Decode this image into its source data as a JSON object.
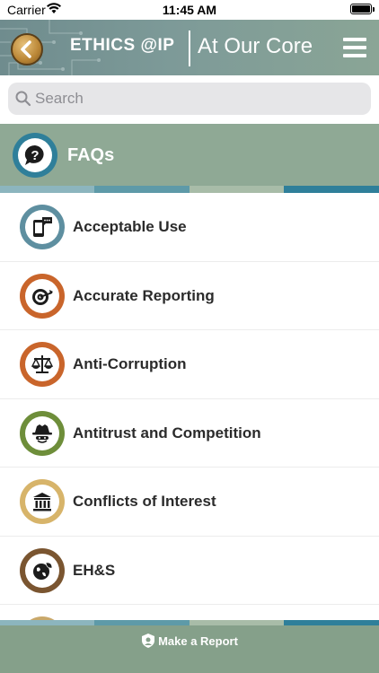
{
  "status_bar": {
    "carrier": "Carrier",
    "time": "11:45 AM"
  },
  "header": {
    "brand": "ETHICS @IP",
    "tagline": "At Our Core"
  },
  "search": {
    "placeholder": "Search"
  },
  "section": {
    "title": "FAQs",
    "badge_color": "#2f7f9a"
  },
  "faq_items": [
    {
      "label": "Acceptable Use",
      "icon": "phone-chat-icon",
      "color": "#5e8fa0"
    },
    {
      "label": "Accurate Reporting",
      "icon": "target-icon",
      "color": "#c9652b"
    },
    {
      "label": "Anti-Corruption",
      "icon": "scales-icon",
      "color": "#c9652b"
    },
    {
      "label": "Antitrust and Competition",
      "icon": "spy-icon",
      "color": "#6e8e3a"
    },
    {
      "label": "Conflicts of Interest",
      "icon": "bank-icon",
      "color": "#d7b46a"
    },
    {
      "label": "EH&S",
      "icon": "globe-leaf-icon",
      "color": "#7a5530"
    }
  ],
  "bottom_bar": {
    "label": "Make a Report"
  },
  "colors": {
    "header_bg": "#7d9a98",
    "section_bg": "#8fa995",
    "bottom_bg": "#85a08a",
    "accent_teal": "#2f7f9a"
  }
}
